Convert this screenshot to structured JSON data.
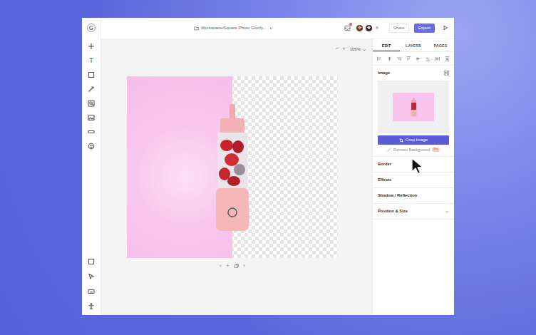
{
  "logo": "G",
  "tools": {
    "text_tool": "T"
  },
  "document": {
    "title": "Workspace/Square Photo Glorify..."
  },
  "notifications": {
    "unread": true
  },
  "collaborators": {
    "count": "8"
  },
  "actions": {
    "share": "Share",
    "export": "Export"
  },
  "zoom": {
    "minus": "−",
    "plus": "+",
    "value": "105%"
  },
  "canvas": {
    "reveal": 0.5
  },
  "pager": {
    "prev": "‹",
    "add": "+",
    "next": "›"
  },
  "panel_tabs": [
    {
      "label": "EDIT",
      "selected": true
    },
    {
      "label": "LAYERS",
      "selected": false
    },
    {
      "label": "PAGES",
      "selected": false
    }
  ],
  "image": {
    "title": "Image",
    "crop": "Crop Image",
    "remove_background": "Remove Background",
    "badge": "Pro"
  },
  "sections": [
    {
      "label": "Border",
      "kind": "plain"
    },
    {
      "label": "Effects",
      "kind": "plain"
    },
    {
      "label": "Shadow / Reflection",
      "kind": "plain"
    },
    {
      "label": "Position & Size",
      "kind": "collapsible"
    }
  ]
}
